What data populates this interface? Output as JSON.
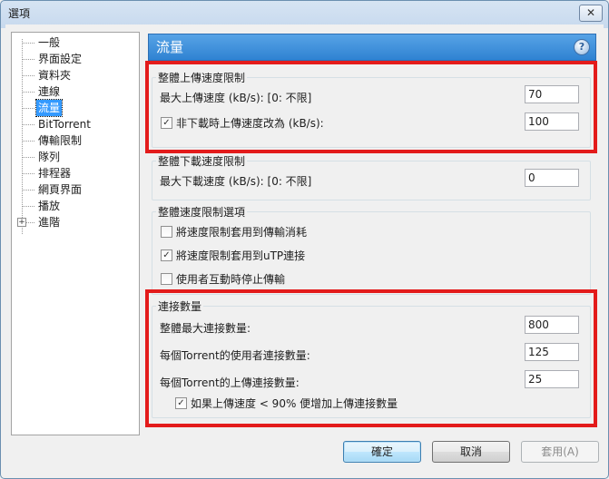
{
  "window": {
    "title": "選項",
    "close_glyph": "✕"
  },
  "tree": {
    "items": [
      {
        "label": "一般"
      },
      {
        "label": "界面設定"
      },
      {
        "label": "資料夾"
      },
      {
        "label": "連線"
      },
      {
        "label": "流量",
        "selected": true
      },
      {
        "label": "BitTorrent"
      },
      {
        "label": "傳輸限制"
      },
      {
        "label": "隊列"
      },
      {
        "label": "排程器"
      },
      {
        "label": "網頁界面"
      },
      {
        "label": "播放"
      },
      {
        "label": "進階",
        "expandable": true
      }
    ],
    "expand_glyph": "+"
  },
  "panel": {
    "title": "流量",
    "help_glyph": "?",
    "upload_group": {
      "title": "整體上傳速度限制",
      "max_upload_label": "最大上傳速度 (kB/s): [0: 不限]",
      "max_upload_value": "70",
      "alt_upload_checkbox_label": "非下載時上傳速度改為 (kB/s):",
      "alt_upload_checked": true,
      "alt_upload_value": "100"
    },
    "download_group": {
      "title": "整體下載速度限制",
      "max_download_label": "最大下載速度 (kB/s): [0: 不限]",
      "max_download_value": "0"
    },
    "options_group": {
      "title": "整體速度限制選項",
      "opt1_label": "將速度限制套用到傳輸消耗",
      "opt1_checked": false,
      "opt2_label": "將速度限制套用到uTP連接",
      "opt2_checked": true,
      "opt3_label": "使用者互動時停止傳輸",
      "opt3_checked": false
    },
    "connections_group": {
      "title": "連接數量",
      "global_max_label": "整體最大連接數量:",
      "global_max_value": "800",
      "per_torrent_peers_label": "每個Torrent的使用者連接數量:",
      "per_torrent_peers_value": "125",
      "per_torrent_upload_label": "每個Torrent的上傳連接數量:",
      "per_torrent_upload_value": "25",
      "auto_increase_label": "如果上傳速度 < 90% 便增加上傳連接數量",
      "auto_increase_checked": true
    }
  },
  "buttons": {
    "ok": "確定",
    "cancel": "取消",
    "apply": "套用(A)"
  },
  "colors": {
    "highlight_red": "#e31b1b",
    "header_blue": "#3a8edb",
    "selection_blue": "#3399ff"
  }
}
